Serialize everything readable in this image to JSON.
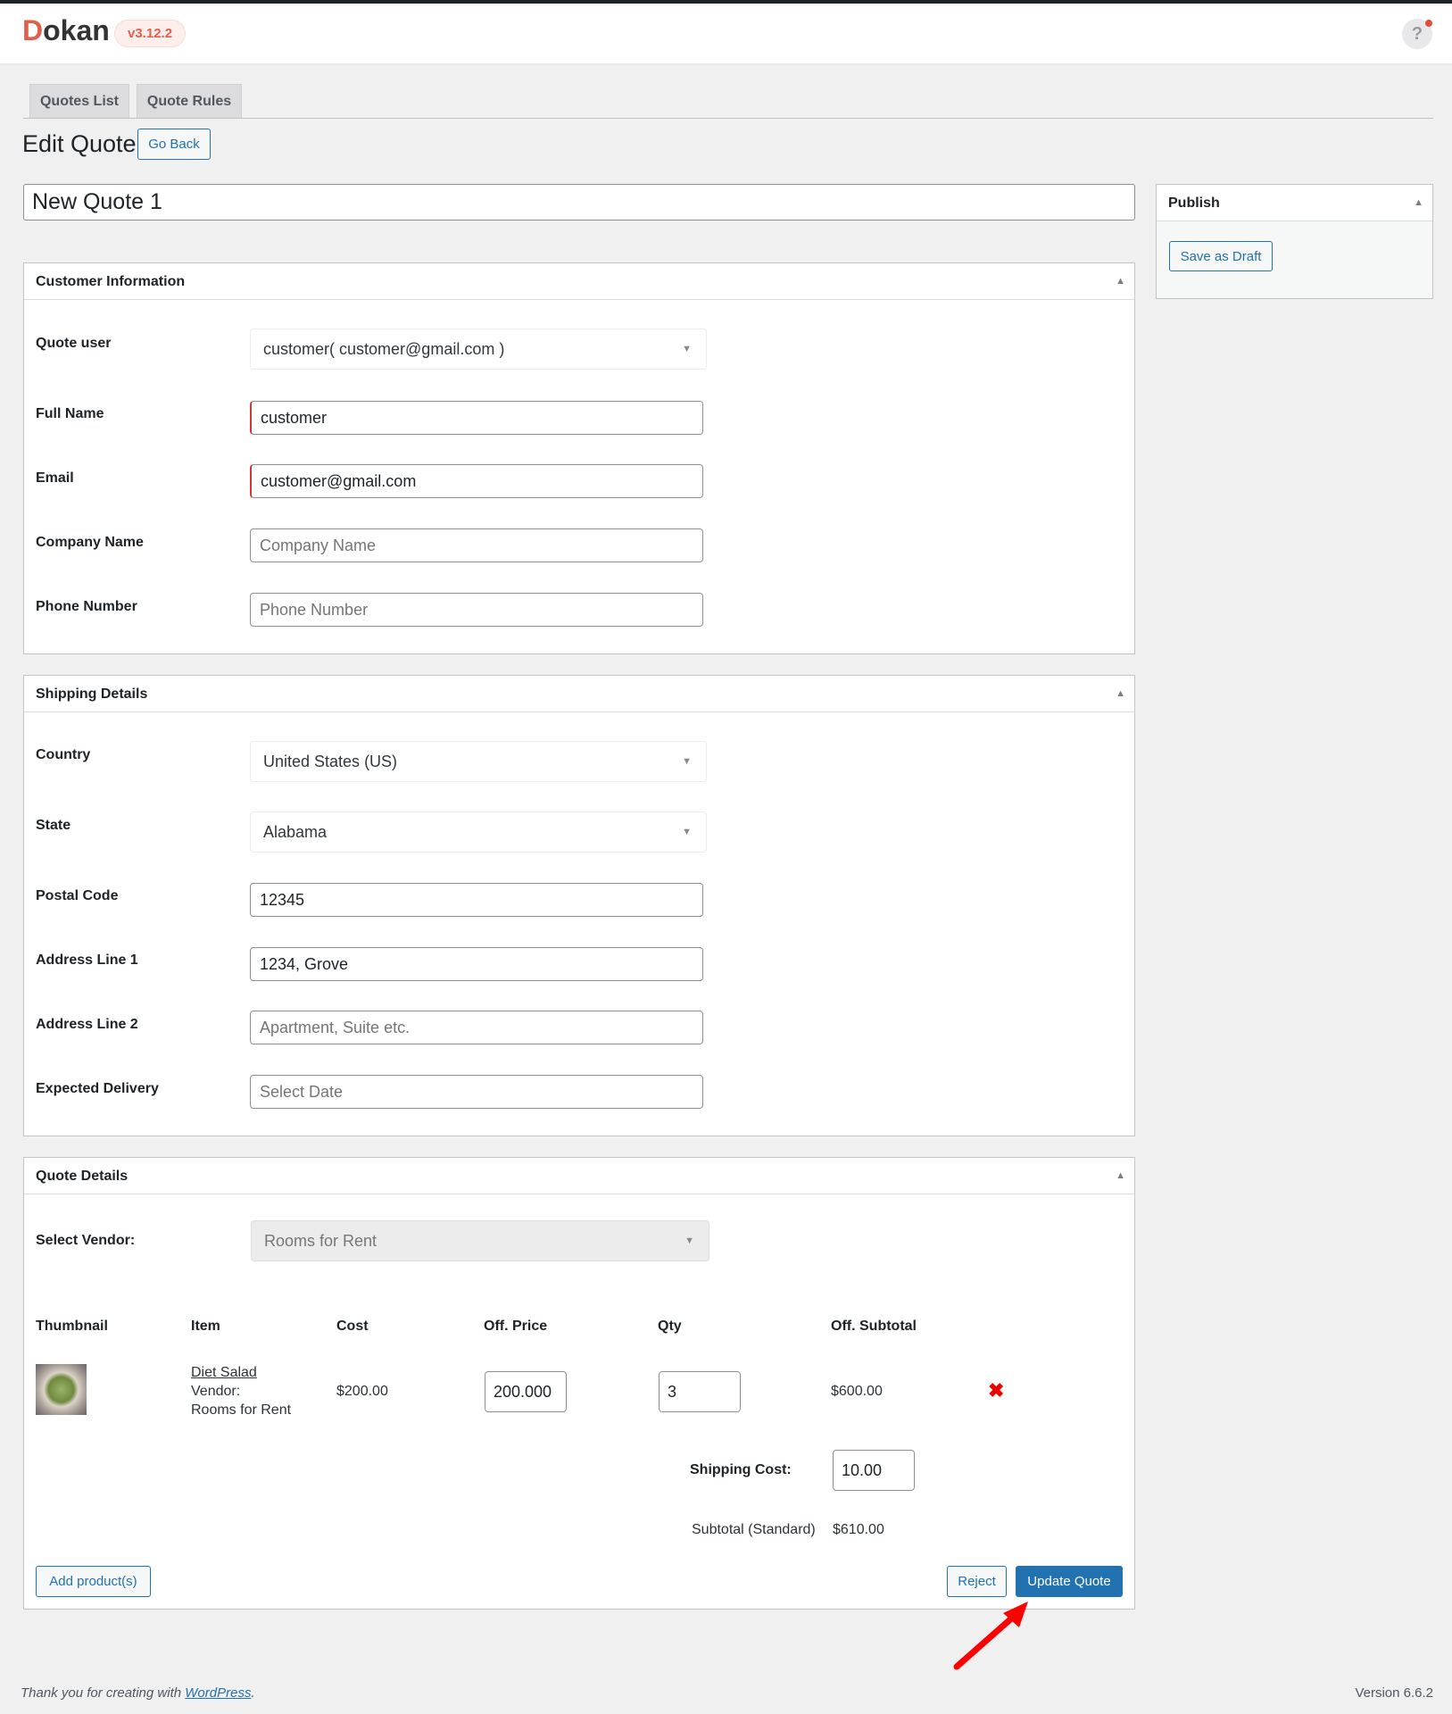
{
  "header": {
    "logo": "Dokan",
    "version": "v3.12.2",
    "help_label": "?"
  },
  "tabs": [
    {
      "label": "Quotes List"
    },
    {
      "label": "Quote Rules"
    }
  ],
  "page": {
    "title": "Edit Quote",
    "go_back": "Go Back",
    "quote_title": "New Quote 1"
  },
  "publish": {
    "title": "Publish",
    "save_draft": "Save as Draft"
  },
  "customer": {
    "title": "Customer Information",
    "quote_user_label": "Quote user",
    "quote_user_value": "customer( customer@gmail.com )",
    "full_name_label": "Full Name",
    "full_name_value": "customer",
    "email_label": "Email",
    "email_value": "customer@gmail.com",
    "company_label": "Company Name",
    "company_placeholder": "Company Name",
    "phone_label": "Phone Number",
    "phone_placeholder": "Phone Number"
  },
  "shipping": {
    "title": "Shipping Details",
    "country_label": "Country",
    "country_value": "United States (US)",
    "state_label": "State",
    "state_value": "Alabama",
    "postal_label": "Postal Code",
    "postal_value": "12345",
    "addr1_label": "Address Line 1",
    "addr1_value": "1234, Grove",
    "addr2_label": "Address Line 2",
    "addr2_placeholder": "Apartment, Suite etc.",
    "delivery_label": "Expected Delivery",
    "delivery_placeholder": "Select Date"
  },
  "quote": {
    "title": "Quote Details",
    "vendor_label": "Select Vendor:",
    "vendor_value": "Rooms for Rent",
    "columns": [
      "Thumbnail",
      "Item",
      "Cost",
      "Off. Price",
      "Qty",
      "Off. Subtotal"
    ],
    "items": [
      {
        "name": "Diet Salad",
        "vendor_label": "Vendor:",
        "vendor": "Rooms for Rent",
        "cost": "$200.00",
        "off_price": "200.000",
        "qty": "3",
        "off_subtotal": "$600.00"
      }
    ],
    "shipping_cost_label": "Shipping Cost:",
    "shipping_cost": "10.00",
    "subtotal_label": "Subtotal (Standard)",
    "subtotal": "$610.00",
    "add_products": "Add product(s)",
    "reject": "Reject",
    "update": "Update Quote"
  },
  "footer": {
    "thanks": "Thank you for creating with ",
    "wp_link": "WordPress",
    "period": ".",
    "version": "Version 6.6.2"
  },
  "colors": {
    "accent": "#2271b1",
    "brand": "#e15e4b",
    "required": "#d63638",
    "annotation_arrow": "#ff0000"
  }
}
